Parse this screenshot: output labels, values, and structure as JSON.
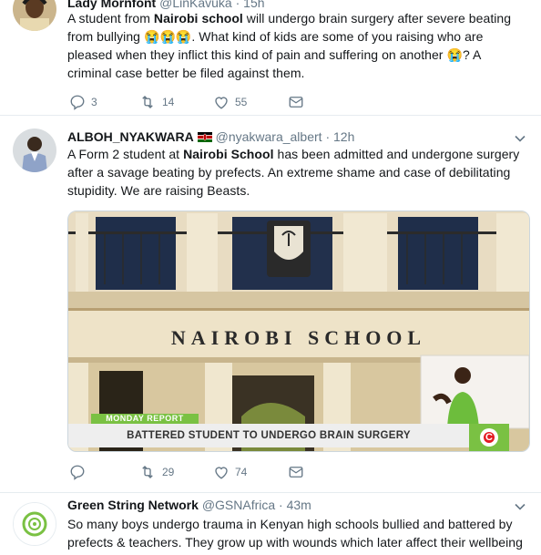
{
  "tweets": [
    {
      "name": "Lady Mornfont",
      "handle": "@LinKavuka",
      "time": "15h",
      "text_parts": [
        "A student from ",
        "Nairobi school",
        " will undergo brain surgery after severe beating from bullying ",
        "😭😭😭",
        ". What kind of kids are some of you raising who are pleased when they inflict this kind of pain and suffering on another ",
        "😭",
        "? A criminal case better be filed against them."
      ],
      "replies": "3",
      "retweets": "14",
      "likes": "55"
    },
    {
      "name": "ALBOH_NYAKWARA",
      "handle": "@nyakwara_albert",
      "time": "12h",
      "text_parts": [
        "A Form 2 student at ",
        "Nairobi School",
        " has been admitted and undergone surgery after a savage beating by prefects. An extreme shame and case of debilitating stupidity. We are raising Beasts."
      ],
      "replies": "",
      "retweets": "29",
      "likes": "74",
      "media": {
        "building_sign": "NAIROBI SCHOOL",
        "banner_label": "MONDAY REPORT",
        "headline": "BATTERED STUDENT TO UNDERGO BRAIN SURGERY",
        "channel_logo": "C"
      }
    },
    {
      "name": "Green String Network",
      "handle": "@GSNAfrica",
      "time": "43m",
      "text": "So many boys undergo trauma in Kenyan high schools bullied and battered by prefects & teachers. They grow up with wounds which later affect their wellbeing"
    }
  ],
  "separator": "·",
  "colors": {
    "text": "#14171a",
    "muted": "#657786",
    "border": "#e6ecf0",
    "green": "#7ac143",
    "nation_red": "#e31b23"
  },
  "icons": [
    "reply-icon",
    "retweet-icon",
    "like-icon",
    "dm-icon",
    "chevron-down-icon",
    "kenya-flag-icon"
  ]
}
